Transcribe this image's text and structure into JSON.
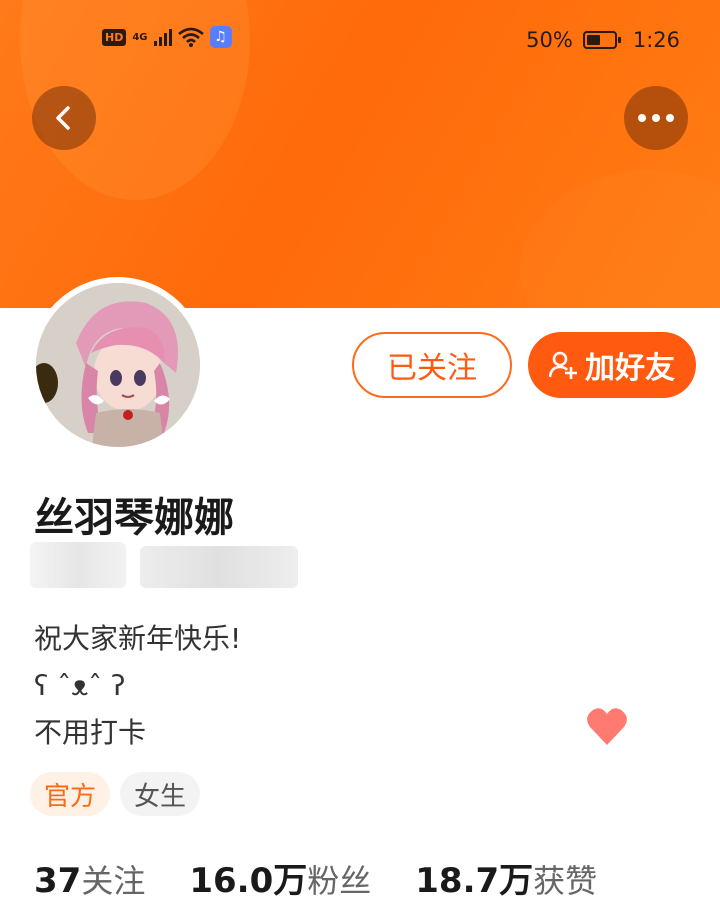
{
  "status_bar": {
    "network_badge": "HD",
    "signal_type": "4G",
    "battery_percent": "50%",
    "time": "1:26"
  },
  "header": {
    "back_icon": "chevron-left-icon",
    "more_icon": "more-dots-icon",
    "banner_color": "#ff7a1a"
  },
  "profile": {
    "username": "丝羽琴娜娜",
    "bio_lines": [
      "祝大家新年快乐!",
      "ʕ ˆᴥˆ ʔ",
      "不用打卡"
    ],
    "tags": [
      "官方",
      "女生"
    ]
  },
  "actions": {
    "followed_label": "已关注",
    "add_friend_label": "加好友",
    "accent": "#ff5a10"
  },
  "stats": [
    {
      "value": "37",
      "label": "关注"
    },
    {
      "value": "16.0万",
      "label": "粉丝"
    },
    {
      "value": "18.7万",
      "label": "获赞"
    }
  ]
}
